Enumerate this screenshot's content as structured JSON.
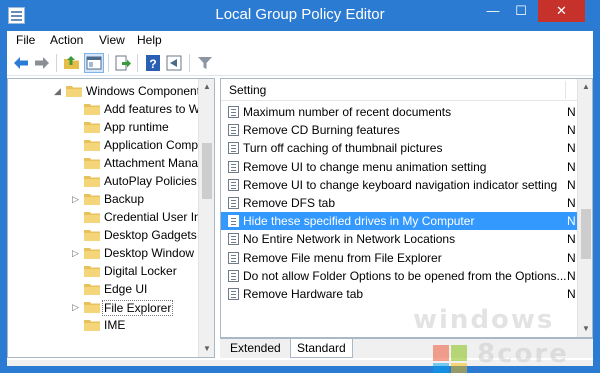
{
  "window": {
    "title": "Local Group Policy Editor",
    "minimize_glyph": "—",
    "maximize_glyph": "☐",
    "close_glyph": "✕",
    "accent_color": "#2b7bd3",
    "close_color": "#c7312b"
  },
  "menubar": {
    "items": [
      "File",
      "Action",
      "View",
      "Help"
    ]
  },
  "toolbar": {
    "buttons": [
      "back-arrow-icon",
      "forward-arrow-icon",
      "up-folder-icon",
      "show-hide-console-tree-icon",
      "export-list-icon",
      "help-icon",
      "properties-icon",
      "filter-icon"
    ]
  },
  "tree": {
    "items": [
      {
        "label": "Windows Component",
        "expander": "◢"
      },
      {
        "label": "Add features to W",
        "expander": ""
      },
      {
        "label": "App runtime",
        "expander": ""
      },
      {
        "label": "Application Comp",
        "expander": ""
      },
      {
        "label": "Attachment Mana",
        "expander": ""
      },
      {
        "label": "AutoPlay Policies",
        "expander": ""
      },
      {
        "label": "Backup",
        "expander": "▷"
      },
      {
        "label": "Credential User Int",
        "expander": ""
      },
      {
        "label": "Desktop Gadgets",
        "expander": ""
      },
      {
        "label": "Desktop Window M",
        "expander": "▷"
      },
      {
        "label": "Digital Locker",
        "expander": ""
      },
      {
        "label": "Edge UI",
        "expander": ""
      },
      {
        "label": "File Explorer",
        "expander": "▷",
        "selected": true
      },
      {
        "label": "IME",
        "expander": ""
      }
    ]
  },
  "list": {
    "column_header": "Setting",
    "rows": [
      {
        "setting": "Maximum number of recent documents",
        "state": "N"
      },
      {
        "setting": "Remove CD Burning features",
        "state": "N"
      },
      {
        "setting": "Turn off caching of thumbnail pictures",
        "state": "N"
      },
      {
        "setting": "Remove UI to change menu animation setting",
        "state": "N"
      },
      {
        "setting": "Remove UI to change keyboard navigation indicator setting",
        "state": "N"
      },
      {
        "setting": "Remove DFS tab",
        "state": "N"
      },
      {
        "setting": "Hide these specified drives in My Computer",
        "state": "N",
        "selected": true
      },
      {
        "setting": "No Entire Network in Network Locations",
        "state": "N"
      },
      {
        "setting": "Remove File menu from File Explorer",
        "state": "N"
      },
      {
        "setting": "Do not allow Folder Options to be opened from the Options...",
        "state": "N"
      },
      {
        "setting": "Remove Hardware tab",
        "state": "N"
      }
    ]
  },
  "tabs": {
    "extended": "Extended",
    "standard": "Standard"
  },
  "watermark": {
    "line1": "windows",
    "line2": "8core"
  }
}
